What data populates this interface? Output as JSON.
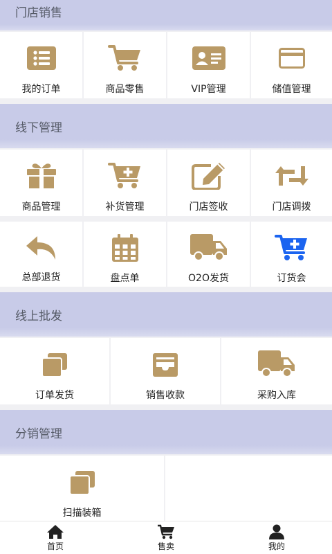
{
  "sections": {
    "store_sales": "门店销售",
    "offline": "线下管理",
    "online": "线上批发",
    "distribution": "分销管理"
  },
  "store_sales_items": [
    "我的订单",
    "商品零售",
    "VIP管理",
    "储值管理"
  ],
  "offline_row1": [
    "商品管理",
    "补货管理",
    "门店签收",
    "门店调拨"
  ],
  "offline_row2": [
    "总部退货",
    "盘点单",
    "O2O发货",
    "订货会"
  ],
  "online_items": [
    "订单发货",
    "销售收款",
    "采购入库"
  ],
  "distribution_items": [
    "扫描装箱"
  ],
  "tabbar": [
    "首页",
    "售卖",
    "我的"
  ],
  "colors": {
    "icon_gold": "#b99a66",
    "icon_blue": "#1b64f0",
    "header_bg": "#c8cbe8"
  }
}
